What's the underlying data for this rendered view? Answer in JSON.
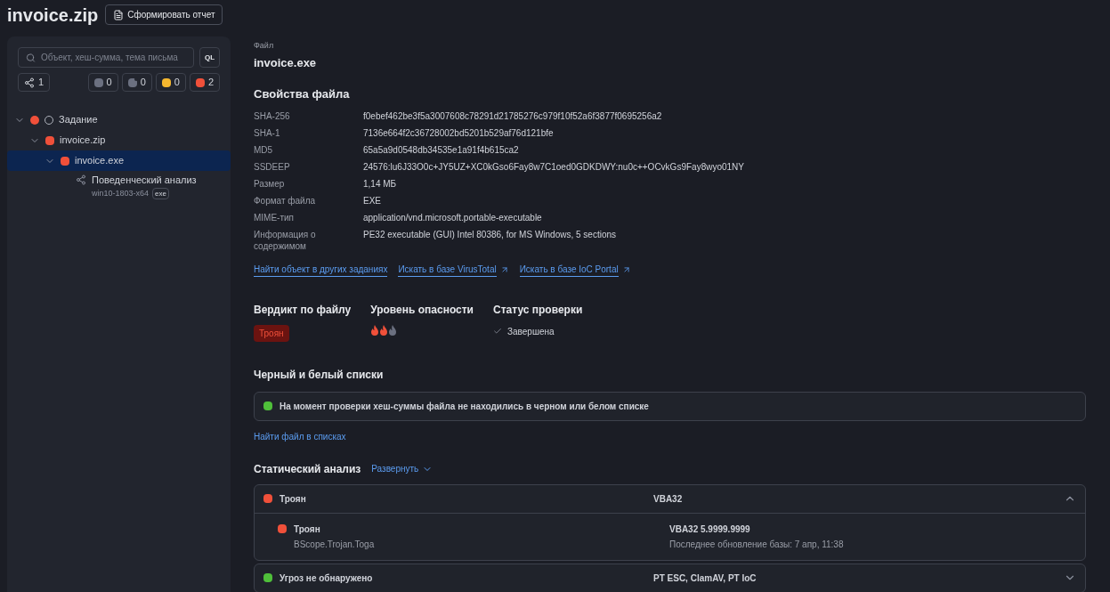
{
  "header": {
    "title": "invoice.zip",
    "report_button": "Сформировать отчет"
  },
  "sidebar": {
    "search": {
      "placeholder": "Объект, хеш-сумма, тема письма"
    },
    "ql_button": "QL",
    "graph_count": "1",
    "counters": [
      {
        "kind": "plain",
        "color": "#6b7080",
        "value": "0"
      },
      {
        "kind": "dotted",
        "color": "#6b7080",
        "value": "0"
      },
      {
        "kind": "plain",
        "color": "#f5b72f",
        "value": "0"
      },
      {
        "kind": "plain",
        "color": "#f0503a",
        "value": "2"
      }
    ],
    "tree": [
      {
        "kind": "task",
        "label": "Задание",
        "color": "#f0503a",
        "expanded": true,
        "selected": false,
        "children": [
          {
            "kind": "file",
            "label": "invoice.zip",
            "color": "#f0503a",
            "expanded": true,
            "selected": false,
            "children": [
              {
                "kind": "file",
                "label": "invoice.exe",
                "color": "#f0503a",
                "expanded": true,
                "selected": true,
                "children": [
                  {
                    "kind": "analysis",
                    "label": "Поведенческий анализ",
                    "sublabel": "win10-1803-x64",
                    "tag": "exe",
                    "selected": false
                  }
                ]
              }
            ]
          }
        ]
      }
    ]
  },
  "file": {
    "caption": "Файл",
    "name": "invoice.exe"
  },
  "properties": {
    "title": "Свойства файла",
    "rows": [
      {
        "label": "SHA-256",
        "value": "f0ebef462be3f5a3007608c78291d21785276c979f10f52a6f3877f0695256a2"
      },
      {
        "label": "SHA-1",
        "value": "7136e664f2c36728002bd5201b529af76d121bfe"
      },
      {
        "label": "MD5",
        "value": "65a5a9d0548db34535e1a91f4b615ca2"
      },
      {
        "label": "SSDEEP",
        "value": "24576:lu6J33O0c+JY5UZ+XC0kGso6Fay8w7C1oed0GDKDWY:nu0c++OCvkGs9Fay8wyo01NY"
      },
      {
        "label": "Размер",
        "value": "1,14 МБ"
      },
      {
        "label": "Формат файла",
        "value": "EXE"
      },
      {
        "label": "MIME-тип",
        "value": "application/vnd.microsoft.portable-executable"
      },
      {
        "label": "Информация о содержимом",
        "value": "PE32 executable (GUI) Intel 80386, for MS Windows, 5 sections"
      }
    ],
    "links": [
      {
        "label": "Найти объект в других заданиях",
        "external": false
      },
      {
        "label": "Искать в базе VirusTotal",
        "external": true
      },
      {
        "label": "Искать в базе IoC Portal",
        "external": true
      }
    ]
  },
  "verdict": {
    "title": "Вердикт по файлу",
    "value": "Троян"
  },
  "danger": {
    "title": "Уровень опасности",
    "stars": 2
  },
  "status": {
    "title": "Статус проверки",
    "value": "Завершена"
  },
  "lists": {
    "title": "Черный и белый списки",
    "message": "На момент проверки хеш-суммы файла не находились в черном или белом списке",
    "color": "#4fbf3a",
    "link": "Найти файл в списках"
  },
  "static_analysis": {
    "title": "Статический анализ",
    "expand_link": "Развернуть",
    "groups": [
      {
        "label": "Троян",
        "color": "#f0503a",
        "engines": "VBA32",
        "expanded": true,
        "details": [
          {
            "label": "Троян",
            "sublabel": "BScope.Trojan.Toga",
            "engine": "VBA32 5.9999.9999",
            "engine_note": "Последнее обновление базы: 7 апр, 11:38",
            "color": "#f0503a"
          }
        ]
      },
      {
        "label": "Угроз не обнаружено",
        "color": "#4fbf3a",
        "engines": "PT ESC, ClamAV, PT IoC",
        "expanded": false
      }
    ]
  }
}
